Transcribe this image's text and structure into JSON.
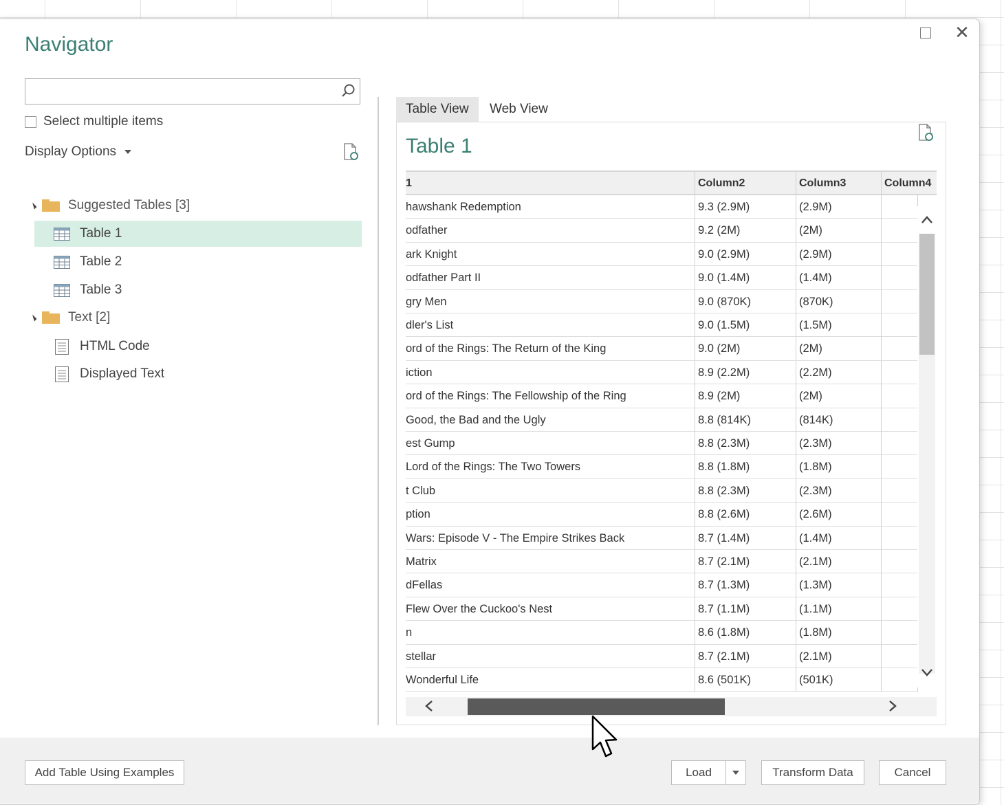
{
  "dialog": {
    "title": "Navigator"
  },
  "search": {
    "placeholder": "",
    "value": ""
  },
  "select_multiple": {
    "label": "Select multiple items",
    "checked": false
  },
  "display_options": {
    "label": "Display Options"
  },
  "tree": {
    "folders": [
      {
        "label": "Suggested Tables [3]",
        "items": [
          "Table 1",
          "Table 2",
          "Table 3"
        ]
      },
      {
        "label": "Text [2]",
        "items": [
          "HTML Code",
          "Displayed Text"
        ]
      }
    ],
    "selected": "Table 1"
  },
  "tabs": {
    "table_view": "Table View",
    "web_view": "Web View",
    "active": "Table View"
  },
  "preview": {
    "title": "Table 1",
    "columns": [
      "1",
      "Column2",
      "Column3",
      "Column4"
    ],
    "rows": [
      [
        "hawshank Redemption",
        "9.3 (2.9M)",
        "(2.9M)",
        ""
      ],
      [
        "odfather",
        "9.2 (2M)",
        "(2M)",
        ""
      ],
      [
        "ark Knight",
        "9.0 (2.9M)",
        "(2.9M)",
        ""
      ],
      [
        "odfather Part II",
        "9.0 (1.4M)",
        "(1.4M)",
        ""
      ],
      [
        "gry Men",
        "9.0 (870K)",
        "(870K)",
        ""
      ],
      [
        "dler's List",
        "9.0 (1.5M)",
        "(1.5M)",
        ""
      ],
      [
        "ord of the Rings: The Return of the King",
        "9.0 (2M)",
        "(2M)",
        ""
      ],
      [
        "iction",
        "8.9 (2.2M)",
        "(2.2M)",
        ""
      ],
      [
        "ord of the Rings: The Fellowship of the Ring",
        "8.9 (2M)",
        "(2M)",
        ""
      ],
      [
        "Good, the Bad and the Ugly",
        "8.8 (814K)",
        "(814K)",
        ""
      ],
      [
        "est Gump",
        "8.8 (2.3M)",
        "(2.3M)",
        ""
      ],
      [
        "Lord of the Rings: The Two Towers",
        "8.8 (1.8M)",
        "(1.8M)",
        ""
      ],
      [
        "t Club",
        "8.8 (2.3M)",
        "(2.3M)",
        ""
      ],
      [
        "ption",
        "8.8 (2.6M)",
        "(2.6M)",
        ""
      ],
      [
        "Wars: Episode V - The Empire Strikes Back",
        "8.7 (1.4M)",
        "(1.4M)",
        ""
      ],
      [
        "Matrix",
        "8.7 (2.1M)",
        "(2.1M)",
        ""
      ],
      [
        "dFellas",
        "8.7 (1.3M)",
        "(1.3M)",
        ""
      ],
      [
        "Flew Over the Cuckoo's Nest",
        "8.7 (1.1M)",
        "(1.1M)",
        ""
      ],
      [
        "n",
        "8.6 (1.8M)",
        "(1.8M)",
        ""
      ],
      [
        "stellar",
        "8.7 (2.1M)",
        "(2.1M)",
        ""
      ],
      [
        "Wonderful Life",
        "8.6 (501K)",
        "(501K)",
        ""
      ]
    ]
  },
  "buttons": {
    "add_table": "Add Table Using Examples",
    "load": "Load",
    "transform": "Transform Data",
    "cancel": "Cancel"
  },
  "colors": {
    "accent": "#3b7f74",
    "selected_row": "#d7eee4",
    "folder": "#e8b55c"
  },
  "icons": {
    "window": [
      "maximize-icon",
      "close-icon"
    ],
    "search": "search-icon",
    "refresh": "refresh-document-icon",
    "folder": "folder-icon",
    "table": "table-icon",
    "text": "text-document-icon"
  }
}
